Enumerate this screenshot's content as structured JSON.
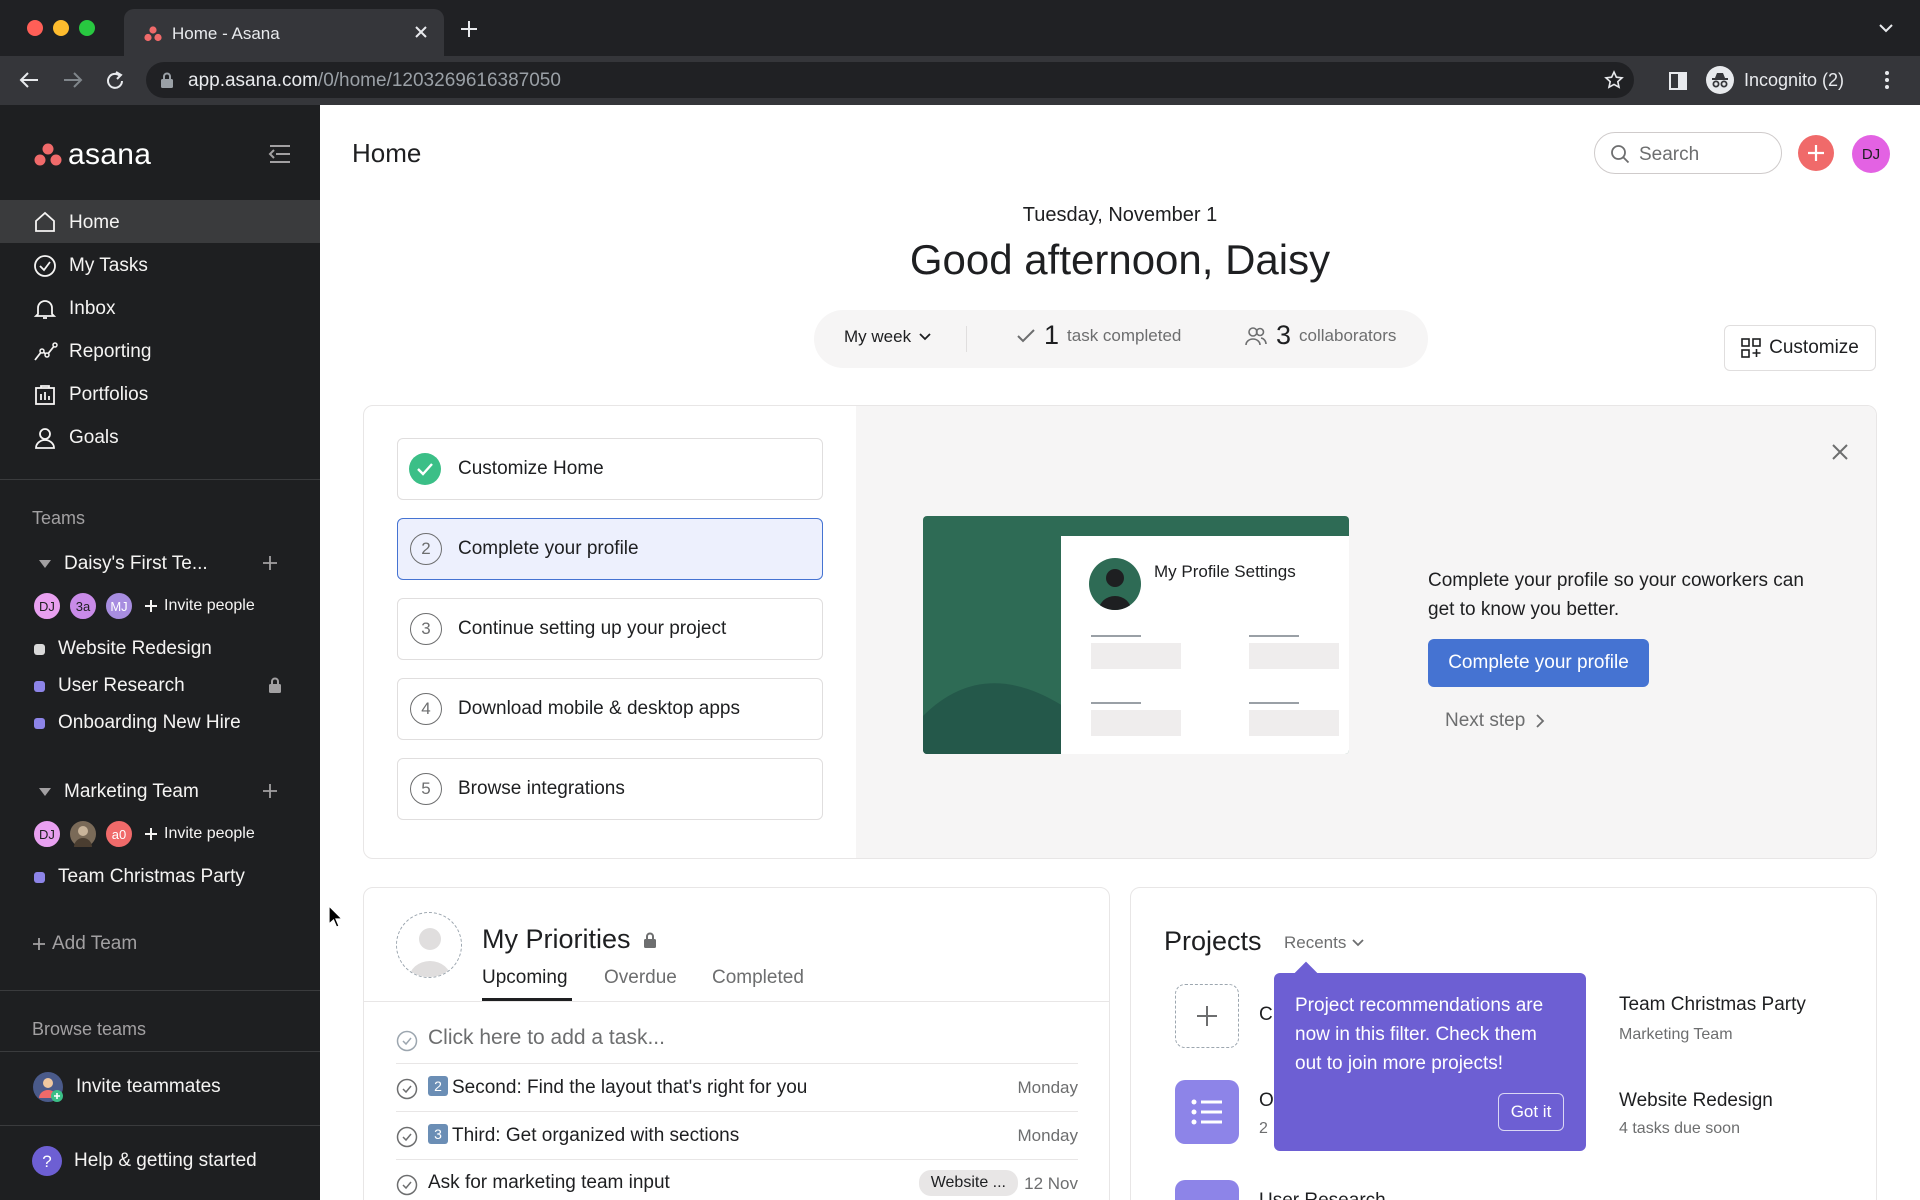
{
  "browser": {
    "tab_title": "Home - Asana",
    "url_domain": "app.asana.com",
    "url_path": "/0/home/1203269616387050",
    "profile_label": "Incognito (2)"
  },
  "sidebar": {
    "logo_text": "asana",
    "nav": [
      {
        "label": "Home",
        "icon": "home-icon"
      },
      {
        "label": "My Tasks",
        "icon": "check-circle-icon"
      },
      {
        "label": "Inbox",
        "icon": "bell-icon"
      },
      {
        "label": "Reporting",
        "icon": "chart-line-icon"
      },
      {
        "label": "Portfolios",
        "icon": "portfolio-icon"
      },
      {
        "label": "Goals",
        "icon": "person-icon"
      }
    ],
    "teams_heading": "Teams",
    "teams": [
      {
        "name": "Daisy's First Te...",
        "members": [
          "DJ",
          "3a",
          "MJ"
        ],
        "invite_label": "Invite people",
        "projects": [
          {
            "name": "Website Redesign",
            "color": "#d9d9d9",
            "private": false
          },
          {
            "name": "User Research",
            "color": "#8d84e8",
            "private": true
          },
          {
            "name": "Onboarding New Hire",
            "color": "#8d84e8",
            "private": false
          }
        ]
      },
      {
        "name": "Marketing Team",
        "members": [
          "DJ",
          "",
          "a0"
        ],
        "invite_label": "Invite people",
        "projects": [
          {
            "name": "Team Christmas Party",
            "color": "#8d84e8",
            "private": false
          }
        ]
      }
    ],
    "add_team_label": "Add Team",
    "browse_teams_label": "Browse teams",
    "invite_teammates_label": "Invite teammates",
    "help_label": "Help & getting started"
  },
  "header": {
    "title": "Home",
    "search_placeholder": "Search",
    "user_initials": "DJ"
  },
  "greeting": {
    "date": "Tuesday, November 1",
    "text": "Good afternoon, Daisy",
    "period_label": "My week",
    "tasks_completed_count": "1",
    "tasks_completed_label": "task completed",
    "collaborators_count": "3",
    "collaborators_label": "collaborators",
    "customize_label": "Customize"
  },
  "setup": {
    "steps": [
      {
        "number": "",
        "label": "Customize Home",
        "state": "done"
      },
      {
        "number": "2",
        "label": "Complete your profile",
        "state": "active"
      },
      {
        "number": "3",
        "label": "Continue setting up your project",
        "state": "todo"
      },
      {
        "number": "4",
        "label": "Download mobile & desktop apps",
        "state": "todo"
      },
      {
        "number": "5",
        "label": "Browse integrations",
        "state": "todo"
      }
    ],
    "illustration_title": "My Profile Settings",
    "description": "Complete your profile so your coworkers can get to know you better.",
    "cta_label": "Complete your profile",
    "next_label": "Next step"
  },
  "priorities": {
    "title": "My Priorities",
    "tabs": [
      "Upcoming",
      "Overdue",
      "Completed"
    ],
    "add_task_placeholder": "Click here to add a task...",
    "tasks": [
      {
        "emoji": "2",
        "text": "Second: Find the layout that's right for you",
        "due": "Monday",
        "tag": ""
      },
      {
        "emoji": "3",
        "text": "Third: Get organized with sections",
        "due": "Monday",
        "tag": ""
      },
      {
        "emoji": "",
        "text": "Ask for marketing team input",
        "due": "12 Nov",
        "tag": "Website ..."
      }
    ]
  },
  "projects": {
    "title": "Projects",
    "filter_label": "Recents",
    "items": [
      {
        "name": "C",
        "sub": ""
      },
      {
        "name": "O",
        "sub": "2"
      },
      {
        "name": "User Research",
        "sub": ""
      },
      {
        "name": "Team Christmas Party",
        "sub": "Marketing Team"
      },
      {
        "name": "Website Redesign",
        "sub": "4 tasks due soon"
      }
    ],
    "tooltip_text": "Project recommendations are now in this filter. Check them out to join more projects!",
    "tooltip_button": "Got it"
  },
  "colors": {
    "sidebar_bg": "#1e1f21",
    "accent_blue": "#4573d2",
    "brand_coral": "#f06a6a",
    "tooltip_purple": "#6d5fd3",
    "success_green": "#3bbf87"
  }
}
